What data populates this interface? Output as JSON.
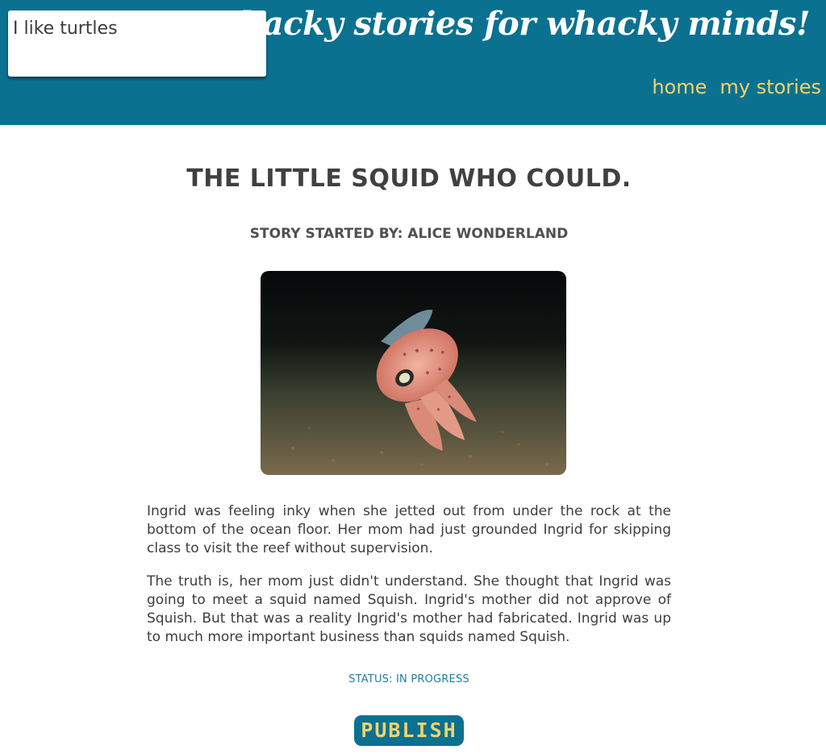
{
  "header": {
    "search_value": "I like turtles",
    "site_title": "whacky stories for whacky minds!",
    "nav": {
      "home": "home",
      "my_stories": "my stories"
    }
  },
  "story": {
    "title": "THE LITTLE SQUID WHO COULD.",
    "author_line": "STORY STARTED BY: ALICE WONDERLAND",
    "image": "squid-photo",
    "paragraphs": [
      "Ingrid was feeling inky when she jetted out from under the rock at the bottom of the ocean floor. Her mom had just grounded Ingrid for skipping class to visit the reef without supervision.",
      "The truth is, her mom just didn't understand. She thought that Ingrid was going to meet a squid named Squish. Ingrid's mother did not approve of Squish. But that was a reality Ingrid's mother had fabricated. Ingrid was up to much more important business than squids named Squish."
    ],
    "status": "STATUS: IN PROGRESS",
    "publish_label": "PUBLISH"
  },
  "colors": {
    "header_bg": "#0b7191",
    "accent": "#f2d36b"
  }
}
